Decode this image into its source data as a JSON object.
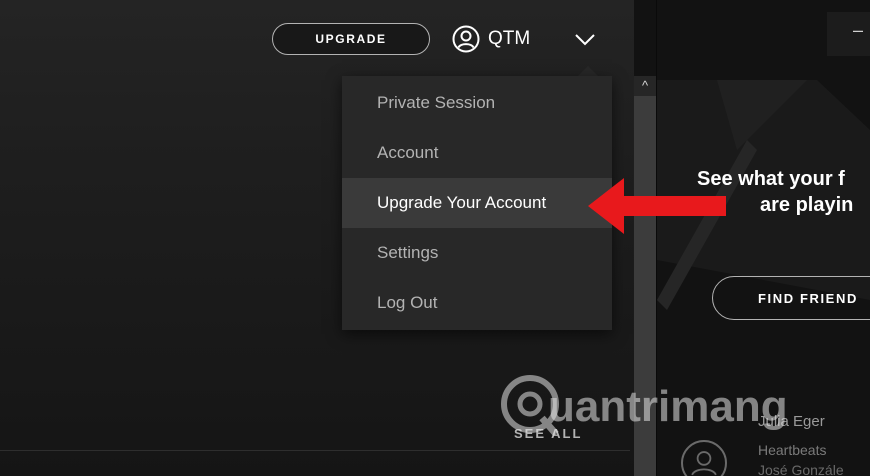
{
  "topbar": {
    "upgrade_label": "UPGRADE",
    "username": "QTM"
  },
  "menu": {
    "items": [
      {
        "label": "Private Session"
      },
      {
        "label": "Account"
      },
      {
        "label": "Upgrade Your Account",
        "highlighted": true
      },
      {
        "label": "Settings"
      },
      {
        "label": "Log Out"
      }
    ]
  },
  "main": {
    "see_all_label": "SEE ALL"
  },
  "friend_activity": {
    "title_line1": "See what your f",
    "title_line2": "are playin",
    "find_button": "FIND FRIEND",
    "friend_name": "Julia Eger",
    "friend_track": "Heartbeats",
    "friend_artist": "José Gonzále",
    "window_glyph": "–"
  },
  "scrollbar": {
    "up_glyph": "^"
  },
  "watermark": {
    "text": "uantrimang"
  },
  "colors": {
    "accent_arrow": "#e8191c",
    "menu_bg": "#282828",
    "menu_highlight": "#3a3a3a"
  },
  "icons": {
    "user": "user-circle-icon",
    "chevron": "chevron-down-icon",
    "arrow": "red-pointer-arrow",
    "friend_avatar": "user-avatar-icon"
  }
}
